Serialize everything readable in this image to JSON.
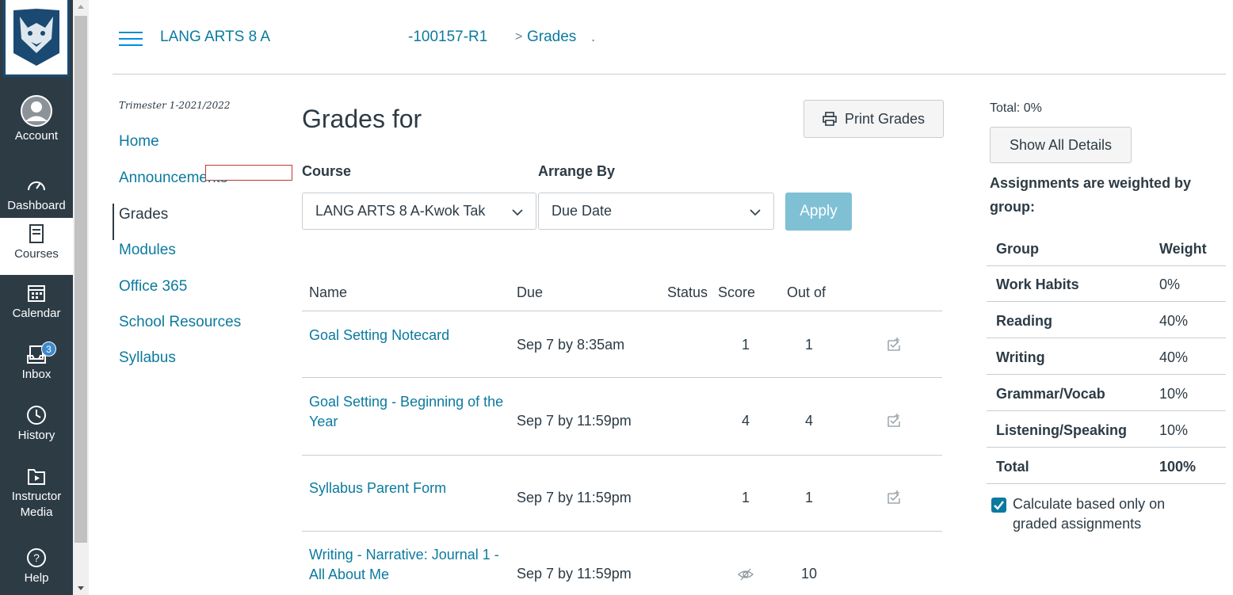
{
  "global_nav": {
    "logo": "wildcat-logo",
    "items": [
      {
        "label": "Account",
        "icon": "account-icon"
      },
      {
        "label": "Dashboard",
        "icon": "dashboard-icon"
      },
      {
        "label": "Courses",
        "icon": "courses-icon"
      },
      {
        "label": "Calendar",
        "icon": "calendar-icon"
      },
      {
        "label": "Inbox",
        "icon": "inbox-icon",
        "badge": "3"
      },
      {
        "label": "History",
        "icon": "history-icon"
      },
      {
        "label": "Instructor Media",
        "icon": "instructor-media-icon"
      },
      {
        "label": "Help",
        "icon": "help-icon"
      }
    ]
  },
  "header": {
    "breadcrumb_course_start": "LANG ARTS 8 A",
    "breadcrumb_course_end": "-100157-R1",
    "breadcrumb_separator": ">",
    "breadcrumb_page": "Grades",
    "breadcrumb_trail": "."
  },
  "course_nav": {
    "term": "Trimester 1-2021/2022",
    "items": [
      {
        "label": "Home"
      },
      {
        "label": "Announcements"
      },
      {
        "label": "Grades"
      },
      {
        "label": "Modules"
      },
      {
        "label": "Office 365"
      },
      {
        "label": "School Resources"
      },
      {
        "label": "Syllabus"
      }
    ]
  },
  "main": {
    "title": "Grades for",
    "print_label": "Print Grades",
    "course_label": "Course",
    "course_value": "LANG ARTS 8 A-Kwok Tak",
    "arrange_label": "Arrange By",
    "arrange_value": "Due Date",
    "apply_label": "Apply",
    "columns": [
      "Name",
      "Due",
      "Status",
      "Score",
      "Out of"
    ],
    "rows": [
      {
        "name": "Goal Setting Notecard",
        "due": "Sep 7 by 8:35am",
        "score": "1",
        "out_of": "1"
      },
      {
        "name": "Goal Setting - Beginning of the Year",
        "due": "Sep 7 by 11:59pm",
        "score": "4",
        "out_of": "4"
      },
      {
        "name": "Syllabus Parent Form",
        "due": "Sep 7 by 11:59pm",
        "score": "1",
        "out_of": "1"
      },
      {
        "name": "Writing - Narrative: Journal 1 - All About Me",
        "due": "Sep 7 by 11:59pm",
        "score": "",
        "out_of": "10"
      }
    ]
  },
  "sidebar": {
    "total": "Total: 0%",
    "show_details": "Show All Details",
    "weighted_note": "Assignments are weighted by group:",
    "weights_header": {
      "group": "Group",
      "weight": "Weight"
    },
    "weights": [
      {
        "group": "Work Habits",
        "weight": "0%"
      },
      {
        "group": "Reading",
        "weight": "40%"
      },
      {
        "group": "Writing",
        "weight": "40%"
      },
      {
        "group": "Grammar/Vocab",
        "weight": "10%"
      },
      {
        "group": "Listening/Speaking",
        "weight": "10%"
      },
      {
        "group": "Total",
        "weight": "100%"
      }
    ],
    "calc_label": "Calculate based only on graded assignments"
  },
  "colors": {
    "nav_bg": "#2d3b45",
    "link": "#0b7a9e",
    "apply_bg": "#7fc0d4",
    "annotation_box": "#c0392b"
  }
}
